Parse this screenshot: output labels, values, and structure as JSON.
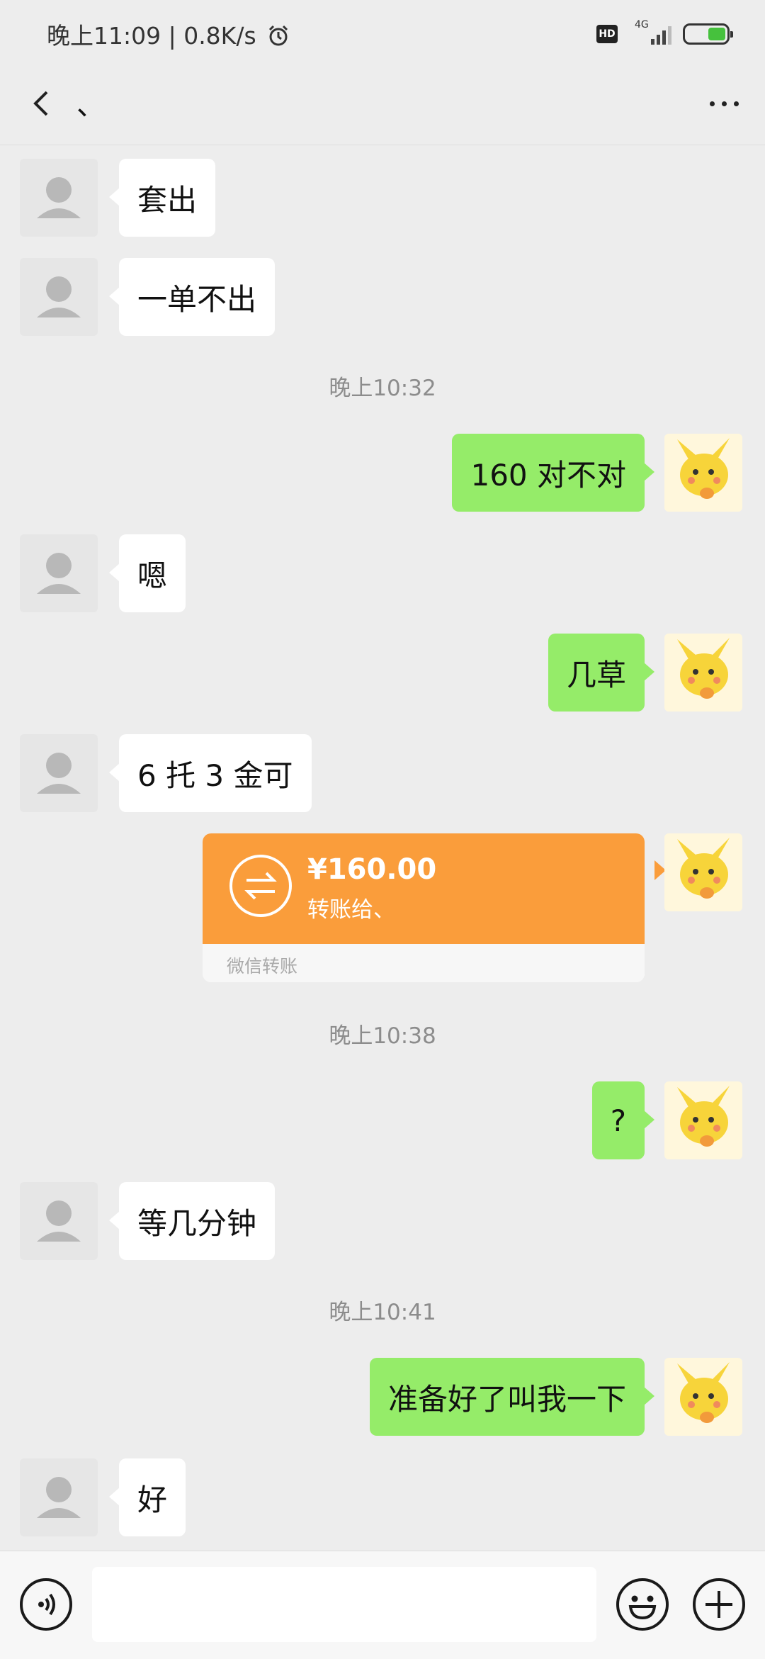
{
  "status_bar": {
    "time_speed": "晚上11:09 | 0.8K/s",
    "hd_label": "HD",
    "network_label": "4G",
    "icons": [
      "alarm-icon",
      "hd-icon",
      "signal-icon",
      "battery-charging-icon"
    ]
  },
  "header": {
    "title": "、",
    "back_icon": "chevron-left-icon",
    "more_icon": "more-dots-icon"
  },
  "messages": [
    {
      "from": "other",
      "text": "套出"
    },
    {
      "from": "other",
      "text": "一单不出"
    },
    {
      "type": "time",
      "text": "晚上10:32"
    },
    {
      "from": "me",
      "text": "160 对不对"
    },
    {
      "from": "other",
      "text": "嗯"
    },
    {
      "from": "me",
      "text": "几草"
    },
    {
      "from": "other",
      "text": "6 托 3 金可"
    },
    {
      "from": "me",
      "type": "transfer",
      "amount": "¥160.00",
      "subtitle": "转账给、",
      "footer": "微信转账"
    },
    {
      "type": "time",
      "text": "晚上10:38"
    },
    {
      "from": "me",
      "text": "?"
    },
    {
      "from": "other",
      "text": "等几分钟"
    },
    {
      "type": "time",
      "text": "晚上10:41"
    },
    {
      "from": "me",
      "text": "准备好了叫我一下"
    },
    {
      "from": "other",
      "text": "好"
    }
  ],
  "input_bar": {
    "voice_icon": "voice-icon",
    "emoji_icon": "emoji-icon",
    "plus_icon": "plus-icon",
    "value": ""
  },
  "colors": {
    "background": "#ededed",
    "my_bubble": "#95ec69",
    "other_bubble": "#ffffff",
    "transfer": "#fa9d3b"
  }
}
